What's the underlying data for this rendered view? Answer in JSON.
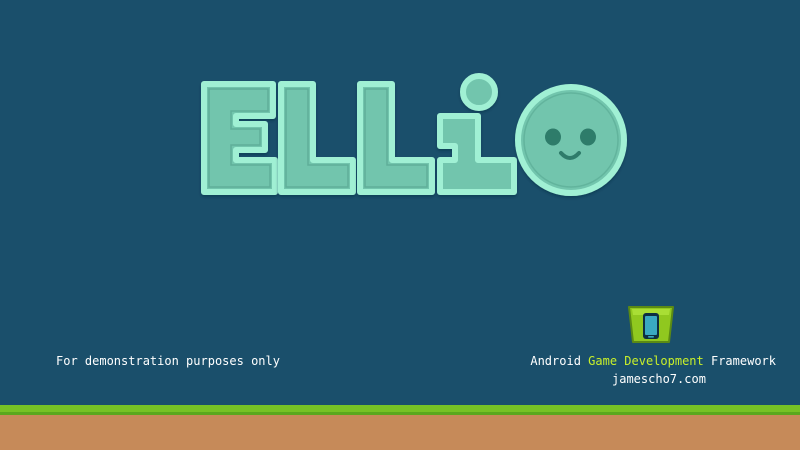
{
  "game": {
    "title_letters": [
      "E",
      "l",
      "l",
      "i"
    ],
    "mascot": "smiling-face",
    "demo_note": "For demonstration purposes only",
    "framework": {
      "prefix": "Android ",
      "highlight": "Game Development",
      "suffix": " Framework",
      "website": "jamescho7.com",
      "icon": "green-bucket-phone-icon"
    }
  },
  "colors": {
    "background": "#1a4f6b",
    "logo_fill": "#72c5ad",
    "logo_outline": "#a0f0d4",
    "logo_shadow": "#3e8e7c",
    "accent_text": "#c8ef2a",
    "grass": "#76c225",
    "dirt": "#c68a59"
  }
}
